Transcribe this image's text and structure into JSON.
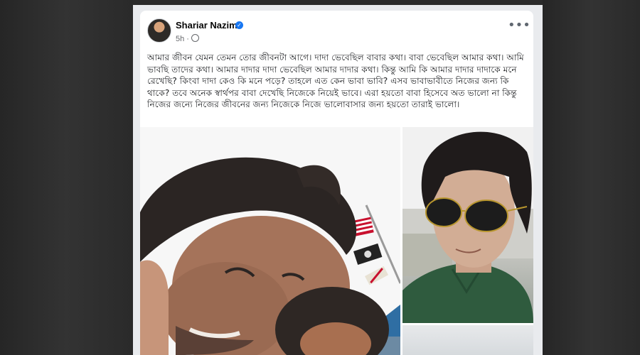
{
  "post": {
    "author": "Shariar Nazim",
    "time": "5h",
    "text": "আমার জীবন যেমন তেমন তোর জীবনটা আগে। দাদা ভেবেছিল বাবার কথা। বাবা ভেবেছিল আমার কথা। আমি ভাবছি তাদের কথা। আমার দাদার দাদা ভেবেছিল আমার দাদার কথা। কিন্তু আমি কি আমার দাদার দাদাকে মনে রেখেছি? কিংবা দাদা কেও কি মনে পড়ে? তাহলে এত কেন ভাবা ভাবি? এসব ভাবাভাবীতে নিজের জন্য কি থাকে? তবে অনেক স্বার্থপর বাবা দেখেছি নিজেকে নিয়েই ভাবে। এরা হয়তো বাবা হিসেবে অত ভালো না কিন্তু নিজের জন্যে নিজের জীবনের জন্য নিজেকে নিজে ভালোবাসার জন্য হয়তো তারাই ভালো।"
  },
  "icons": {
    "verified": "verified-badge-icon",
    "audience": "globe-icon",
    "more": "more-options-icon"
  },
  "colors": {
    "accent": "#1877f2",
    "background": "#2b2b2b"
  }
}
